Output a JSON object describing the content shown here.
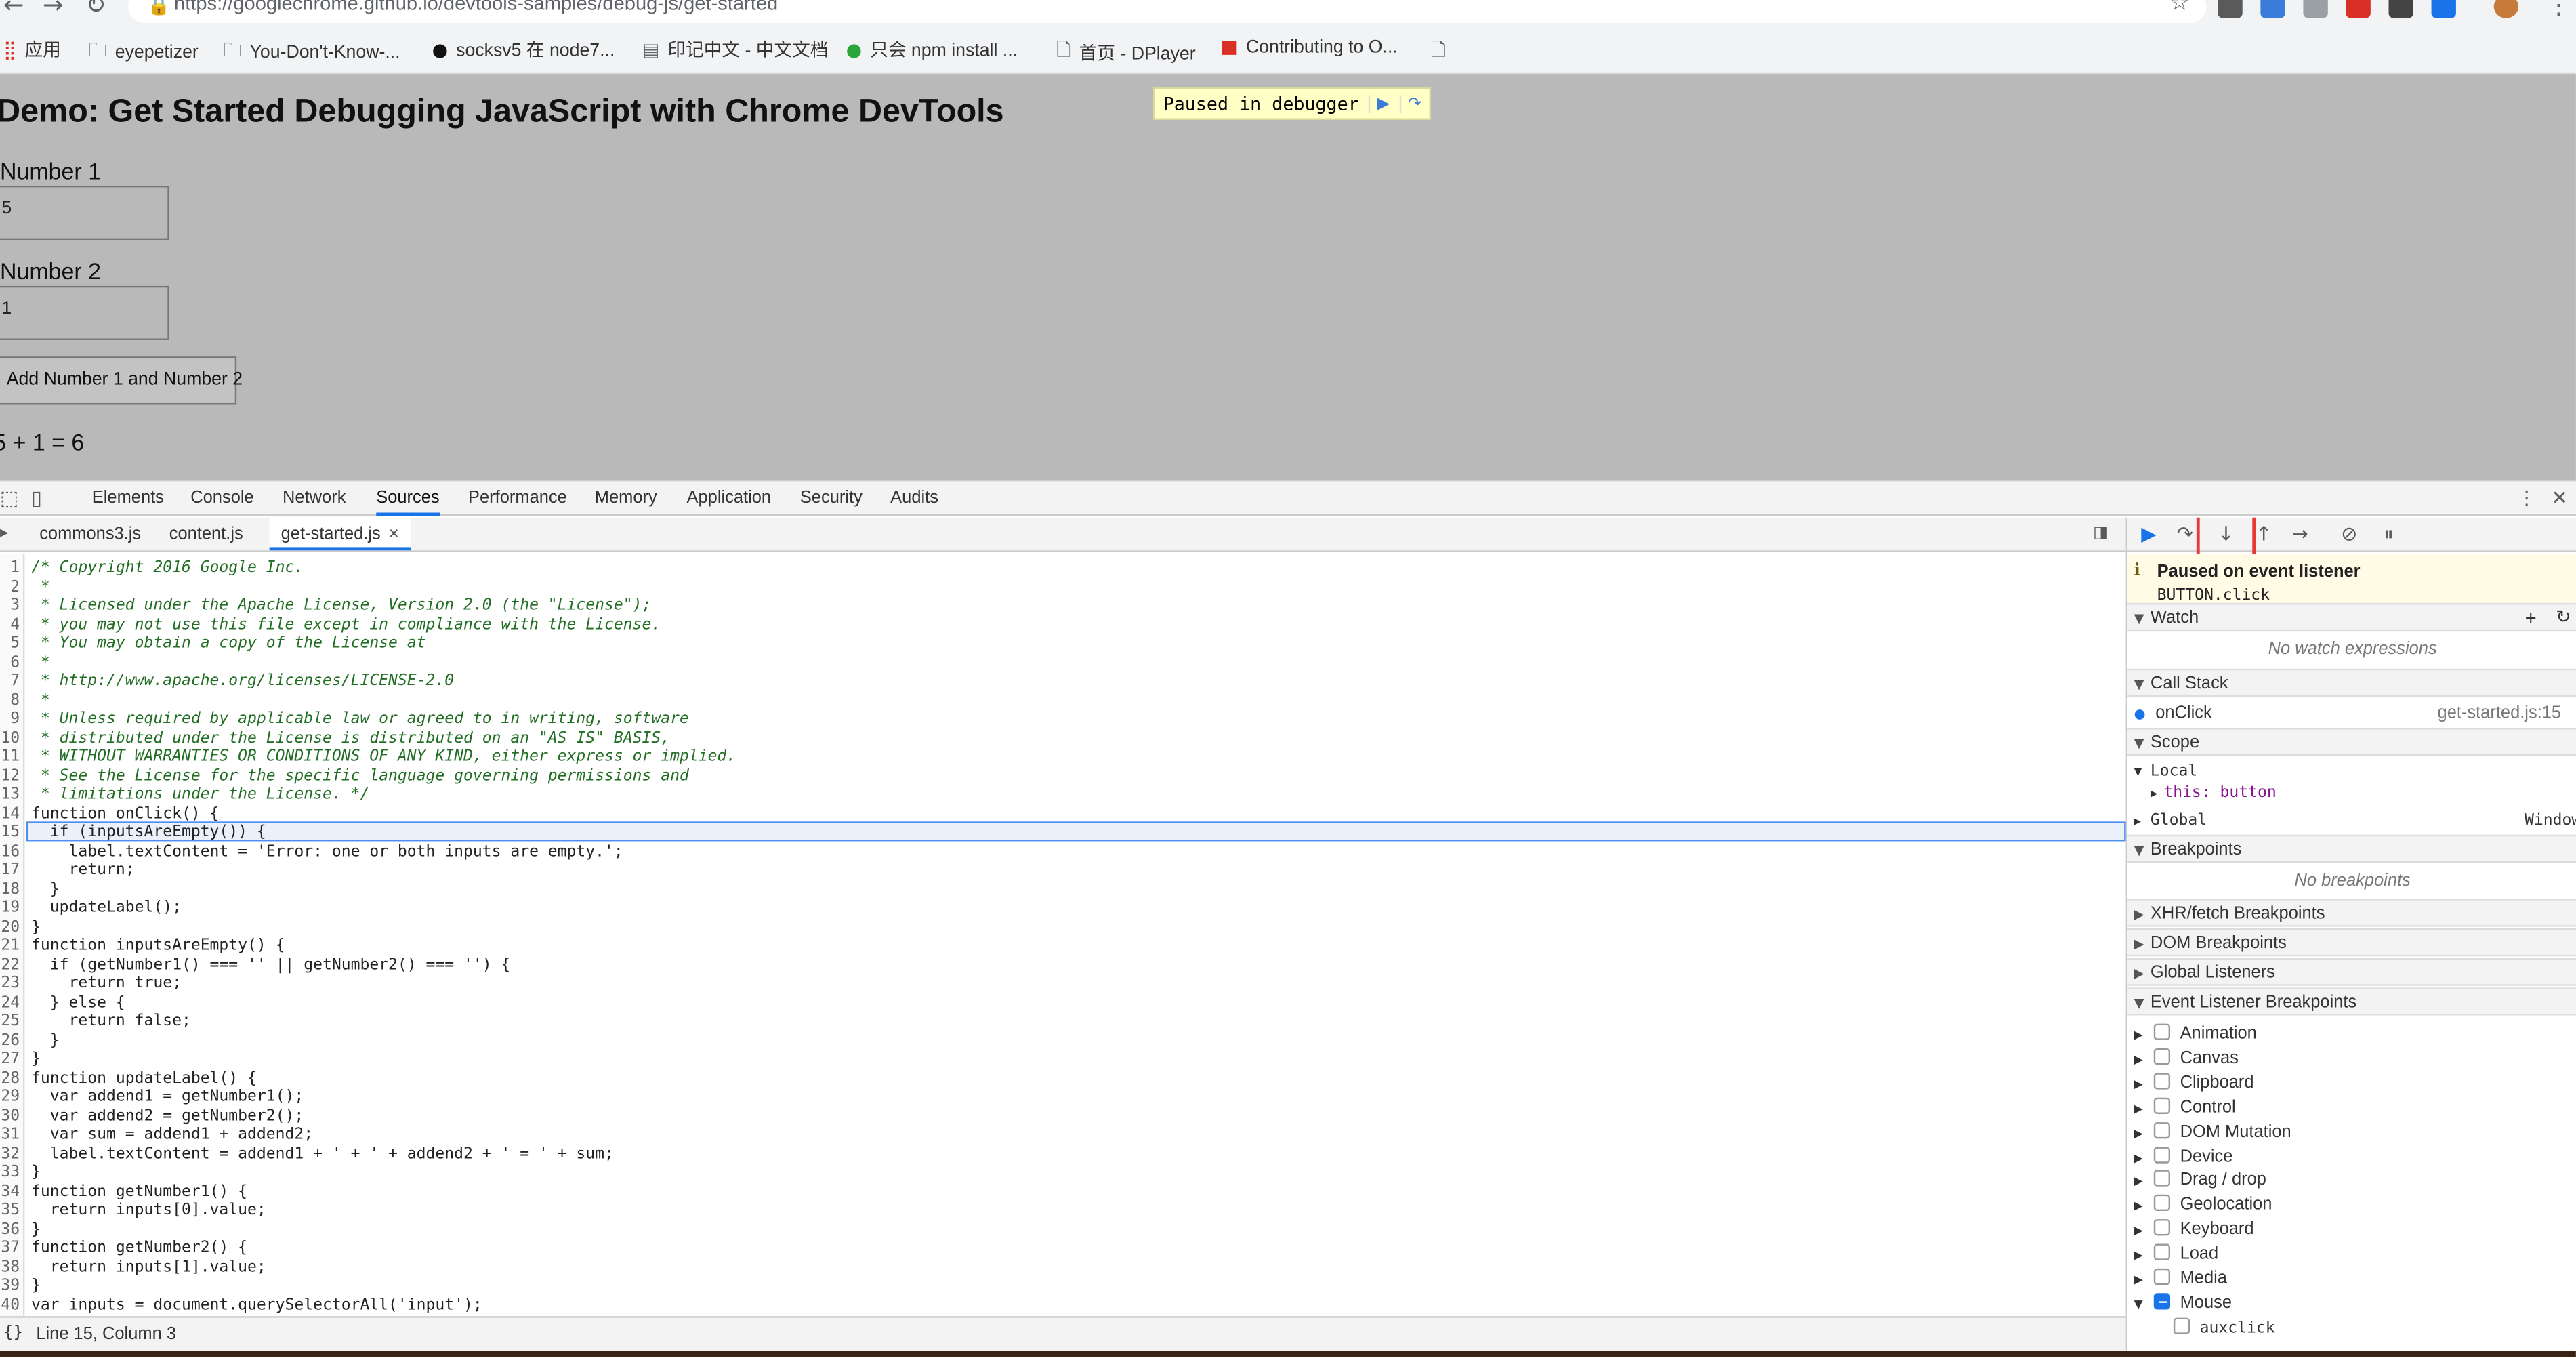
{
  "browser": {
    "url": "https://googlechrome.github.io/devtools-samples/debug-js/get-started",
    "bookmarks": [
      {
        "label": "应用",
        "icon": "apps-grid-icon"
      },
      {
        "label": "eyepetizer",
        "icon": "folder-icon"
      },
      {
        "label": "You-Don't-Know-...",
        "icon": "folder-icon"
      },
      {
        "label": "socksv5 在 node7...",
        "icon": "github-icon"
      },
      {
        "label": "印记中文 - 中文文档",
        "icon": "site-icon"
      },
      {
        "label": "只会 npm install ...",
        "icon": "chat-icon"
      },
      {
        "label": "首页 - DPlayer",
        "icon": "page-icon"
      },
      {
        "label": "Contributing to O...",
        "icon": "site-icon"
      },
      {
        "label": "",
        "icon": "page-icon"
      }
    ]
  },
  "page": {
    "title": "Demo: Get Started Debugging JavaScript with Chrome DevTools",
    "label1": "Number 1",
    "input1": "5",
    "label2": "Number 2",
    "input2": "1",
    "button": "Add Number 1 and Number 2",
    "result": "5 + 1 = 6",
    "paused_overlay": "Paused in debugger"
  },
  "devtools": {
    "tabs": [
      "Elements",
      "Console",
      "Network",
      "Sources",
      "Performance",
      "Memory",
      "Application",
      "Security",
      "Audits"
    ],
    "active_tab": "Sources",
    "file_tabs": [
      "commons3.js",
      "content.js",
      "get-started.js"
    ],
    "active_file": "get-started.js",
    "status": "Line 15, Column 3",
    "status_icon": "{}",
    "sidebar": {
      "paused_title": "Paused on event listener",
      "paused_detail": "BUTTON.click",
      "watch": "Watch",
      "no_watch": "No watch expressions",
      "call_stack": "Call Stack",
      "frame_name": "onClick",
      "frame_loc": "get-started.js:15",
      "scope": "Scope",
      "local": "Local",
      "this_val": "this: button",
      "global": "Global",
      "global_val": "Window",
      "breakpoints": "Breakpoints",
      "no_breakpoints": "No breakpoints",
      "xhr": "XHR/fetch Breakpoints",
      "dom": "DOM Breakpoints",
      "global_listeners": "Global Listeners",
      "event_listener": "Event Listener Breakpoints",
      "events": [
        "Animation",
        "Canvas",
        "Clipboard",
        "Control",
        "DOM Mutation",
        "Device",
        "Drag / drop",
        "Geolocation",
        "Keyboard",
        "Load",
        "Media",
        "Mouse"
      ],
      "sub_event": "auxclick"
    }
  },
  "code": [
    "/* Copyright 2016 Google Inc.",
    " *",
    " * Licensed under the Apache License, Version 2.0 (the \"License\");",
    " * you may not use this file except in compliance with the License.",
    " * You may obtain a copy of the License at",
    " *",
    " * http://www.apache.org/licenses/LICENSE-2.0",
    " *",
    " * Unless required by applicable law or agreed to in writing, software",
    " * distributed under the License is distributed on an \"AS IS\" BASIS,",
    " * WITHOUT WARRANTIES OR CONDITIONS OF ANY KIND, either express or implied.",
    " * See the License for the specific language governing permissions and",
    " * limitations under the License. */",
    "function onClick() {",
    "  if (inputsAreEmpty()) {",
    "    label.textContent = 'Error: one or both inputs are empty.';",
    "    return;",
    "  }",
    "  updateLabel();",
    "}",
    "function inputsAreEmpty() {",
    "  if (getNumber1() === '' || getNumber2() === '') {",
    "    return true;",
    "  } else {",
    "    return false;",
    "  }",
    "}",
    "function updateLabel() {",
    "  var addend1 = getNumber1();",
    "  var addend2 = getNumber2();",
    "  var sum = addend1 + addend2;",
    "  label.textContent = addend1 + ' + ' + addend2 + ' = ' + sum;",
    "}",
    "function getNumber1() {",
    "  return inputs[0].value;",
    "}",
    "function getNumber2() {",
    "  return inputs[1].value;",
    "}",
    "var inputs = document.querySelectorAll('input');"
  ],
  "highlight_line": 15
}
